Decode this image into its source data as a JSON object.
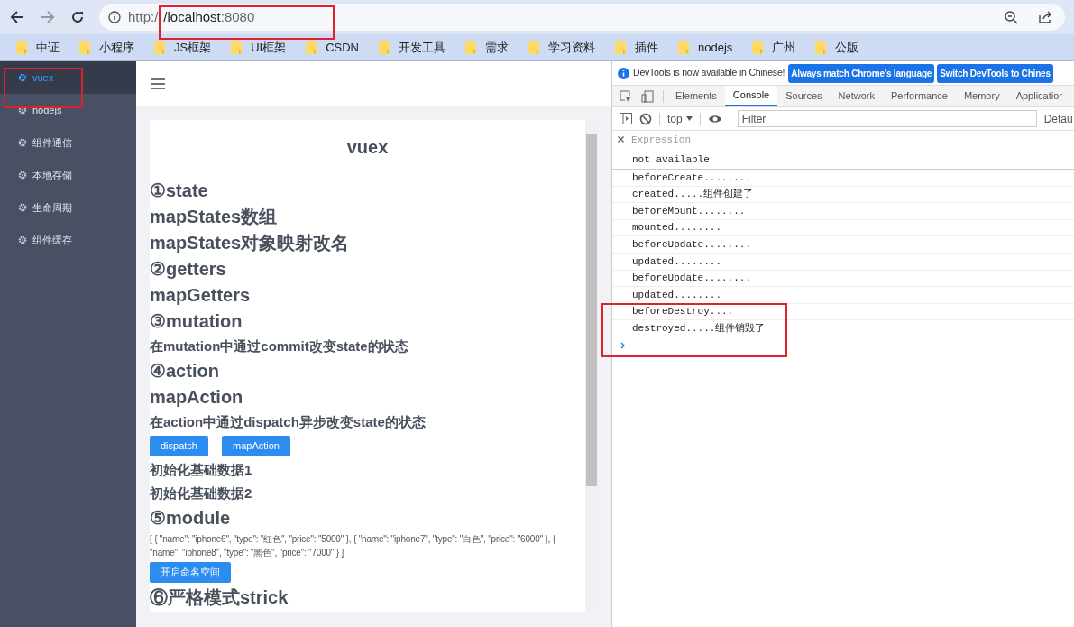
{
  "browser": {
    "url_prefix": "http:/",
    "url_host": "/localhost",
    "url_suffix": ":8080",
    "bookmarks": [
      "中证",
      "小程序",
      "JS框架",
      "UI框架",
      "CSDN",
      "开发工具",
      "需求",
      "学习资料",
      "插件",
      "nodejs",
      "广州",
      "公版"
    ]
  },
  "sidebar": {
    "items": [
      {
        "label": "vuex",
        "selected": true
      },
      {
        "label": "nodejs",
        "selected": false
      },
      {
        "label": "组件通信",
        "selected": false
      },
      {
        "label": "本地存储",
        "selected": false
      },
      {
        "label": "生命周期",
        "selected": false
      },
      {
        "label": "组件缓存",
        "selected": false
      }
    ]
  },
  "content": {
    "title": "vuex",
    "blocks": [
      {
        "kind": "heading",
        "text": "①state"
      },
      {
        "kind": "heading",
        "text": "mapStates数组"
      },
      {
        "kind": "heading",
        "text": "mapStates对象映射改名"
      },
      {
        "kind": "heading",
        "text": "②getters"
      },
      {
        "kind": "heading",
        "text": "mapGetters"
      },
      {
        "kind": "heading",
        "text": "③mutation"
      },
      {
        "kind": "text",
        "text": "在mutation中通过commit改变state的状态"
      },
      {
        "kind": "heading",
        "text": "④action"
      },
      {
        "kind": "heading",
        "text": "mapAction"
      },
      {
        "kind": "text",
        "text": "在action中通过dispatch异步改变state的状态"
      },
      {
        "kind": "buttons",
        "labels": [
          "dispatch",
          "mapAction"
        ]
      },
      {
        "kind": "text",
        "text": "初始化基础数据1"
      },
      {
        "kind": "text",
        "text": "初始化基础数据2"
      },
      {
        "kind": "heading",
        "text": "⑤module"
      },
      {
        "kind": "code",
        "text": "[ { \"name\": \"iphone6\", \"type\": \"红色\", \"price\": \"5000\" }, { \"name\": \"iphone7\", \"type\": \"白色\", \"price\": \"6000\" }, { \"name\": \"iphone8\", \"type\": \"黑色\", \"price\": \"7000\" } ]"
      },
      {
        "kind": "buttons",
        "labels": [
          "开启命名空间"
        ]
      },
      {
        "kind": "heading",
        "text": "⑥严格模式strick"
      }
    ]
  },
  "devtools": {
    "notice": "DevTools is now available in Chinese!",
    "notice_buttons": [
      "Always match Chrome's language",
      "Switch DevTools to Chines"
    ],
    "tabs": [
      {
        "label": "Elements",
        "selected": false
      },
      {
        "label": "Console",
        "selected": true
      },
      {
        "label": "Sources",
        "selected": false
      },
      {
        "label": "Network",
        "selected": false
      },
      {
        "label": "Performance",
        "selected": false
      },
      {
        "label": "Memory",
        "selected": false
      },
      {
        "label": "Applicatior",
        "selected": false
      }
    ],
    "context": "top",
    "filter_placeholder": "Filter",
    "levels": "Defau",
    "expression": {
      "label": "Expression",
      "value": "not available"
    },
    "logs": [
      "beforeCreate........",
      "created.....组件创建了",
      "beforeMount........",
      "mounted........",
      "beforeUpdate........",
      "updated........",
      "beforeUpdate........",
      "updated........",
      "beforeDestroy....",
      "destroyed.....组件销毁了"
    ]
  }
}
